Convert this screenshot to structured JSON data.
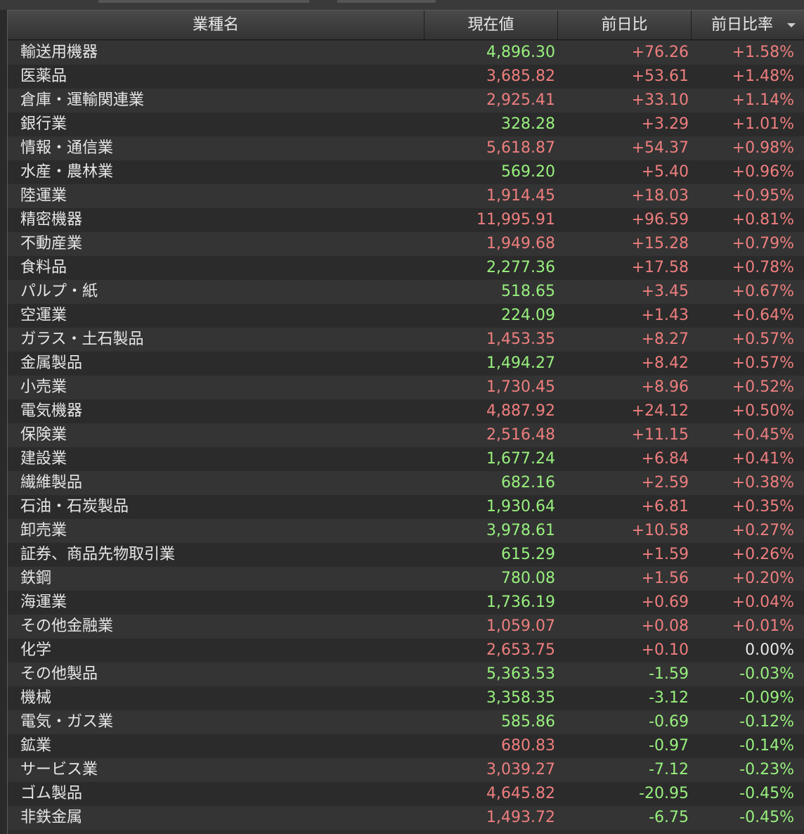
{
  "header": {
    "name": "業種名",
    "price": "現在値",
    "change": "前日比",
    "rate": "前日比率"
  },
  "colors": {
    "up": "#ee7e7e",
    "green": "#98f07e",
    "neutral": "#e8e8e8"
  },
  "rows": [
    {
      "name": "輸送用機器",
      "price": "4,896.30",
      "change": "+76.26",
      "rate": "+1.58%",
      "pc": "green",
      "cc": "up",
      "rc": "up"
    },
    {
      "name": "医薬品",
      "price": "3,685.82",
      "change": "+53.61",
      "rate": "+1.48%",
      "pc": "up",
      "cc": "up",
      "rc": "up"
    },
    {
      "name": "倉庫・運輸関連業",
      "price": "2,925.41",
      "change": "+33.10",
      "rate": "+1.14%",
      "pc": "up",
      "cc": "up",
      "rc": "up"
    },
    {
      "name": "銀行業",
      "price": "328.28",
      "change": "+3.29",
      "rate": "+1.01%",
      "pc": "green",
      "cc": "up",
      "rc": "up"
    },
    {
      "name": "情報・通信業",
      "price": "5,618.87",
      "change": "+54.37",
      "rate": "+0.98%",
      "pc": "up",
      "cc": "up",
      "rc": "up"
    },
    {
      "name": "水産・農林業",
      "price": "569.20",
      "change": "+5.40",
      "rate": "+0.96%",
      "pc": "green",
      "cc": "up",
      "rc": "up"
    },
    {
      "name": "陸運業",
      "price": "1,914.45",
      "change": "+18.03",
      "rate": "+0.95%",
      "pc": "up",
      "cc": "up",
      "rc": "up"
    },
    {
      "name": "精密機器",
      "price": "11,995.91",
      "change": "+96.59",
      "rate": "+0.81%",
      "pc": "up",
      "cc": "up",
      "rc": "up"
    },
    {
      "name": "不動産業",
      "price": "1,949.68",
      "change": "+15.28",
      "rate": "+0.79%",
      "pc": "up",
      "cc": "up",
      "rc": "up"
    },
    {
      "name": "食料品",
      "price": "2,277.36",
      "change": "+17.58",
      "rate": "+0.78%",
      "pc": "green",
      "cc": "up",
      "rc": "up"
    },
    {
      "name": "パルプ・紙",
      "price": "518.65",
      "change": "+3.45",
      "rate": "+0.67%",
      "pc": "green",
      "cc": "up",
      "rc": "up"
    },
    {
      "name": "空運業",
      "price": "224.09",
      "change": "+1.43",
      "rate": "+0.64%",
      "pc": "green",
      "cc": "up",
      "rc": "up"
    },
    {
      "name": "ガラス・土石製品",
      "price": "1,453.35",
      "change": "+8.27",
      "rate": "+0.57%",
      "pc": "up",
      "cc": "up",
      "rc": "up"
    },
    {
      "name": "金属製品",
      "price": "1,494.27",
      "change": "+8.42",
      "rate": "+0.57%",
      "pc": "green",
      "cc": "up",
      "rc": "up"
    },
    {
      "name": "小売業",
      "price": "1,730.45",
      "change": "+8.96",
      "rate": "+0.52%",
      "pc": "up",
      "cc": "up",
      "rc": "up"
    },
    {
      "name": "電気機器",
      "price": "4,887.92",
      "change": "+24.12",
      "rate": "+0.50%",
      "pc": "up",
      "cc": "up",
      "rc": "up"
    },
    {
      "name": "保険業",
      "price": "2,516.48",
      "change": "+11.15",
      "rate": "+0.45%",
      "pc": "up",
      "cc": "up",
      "rc": "up"
    },
    {
      "name": "建設業",
      "price": "1,677.24",
      "change": "+6.84",
      "rate": "+0.41%",
      "pc": "green",
      "cc": "up",
      "rc": "up"
    },
    {
      "name": "繊維製品",
      "price": "682.16",
      "change": "+2.59",
      "rate": "+0.38%",
      "pc": "green",
      "cc": "up",
      "rc": "up"
    },
    {
      "name": "石油・石炭製品",
      "price": "1,930.64",
      "change": "+6.81",
      "rate": "+0.35%",
      "pc": "green",
      "cc": "up",
      "rc": "up"
    },
    {
      "name": "卸売業",
      "price": "3,978.61",
      "change": "+10.58",
      "rate": "+0.27%",
      "pc": "green",
      "cc": "up",
      "rc": "up"
    },
    {
      "name": "証券、商品先物取引業",
      "price": "615.29",
      "change": "+1.59",
      "rate": "+0.26%",
      "pc": "green",
      "cc": "up",
      "rc": "up"
    },
    {
      "name": "鉄鋼",
      "price": "780.08",
      "change": "+1.56",
      "rate": "+0.20%",
      "pc": "green",
      "cc": "up",
      "rc": "up"
    },
    {
      "name": "海運業",
      "price": "1,736.19",
      "change": "+0.69",
      "rate": "+0.04%",
      "pc": "green",
      "cc": "up",
      "rc": "up"
    },
    {
      "name": "その他金融業",
      "price": "1,059.07",
      "change": "+0.08",
      "rate": "+0.01%",
      "pc": "up",
      "cc": "up",
      "rc": "up"
    },
    {
      "name": "化学",
      "price": "2,653.75",
      "change": "+0.10",
      "rate": "0.00%",
      "pc": "up",
      "cc": "up",
      "rc": "neutral"
    },
    {
      "name": "その他製品",
      "price": "5,363.53",
      "change": "-1.59",
      "rate": "-0.03%",
      "pc": "green",
      "cc": "green",
      "rc": "green"
    },
    {
      "name": "機械",
      "price": "3,358.35",
      "change": "-3.12",
      "rate": "-0.09%",
      "pc": "green",
      "cc": "green",
      "rc": "green"
    },
    {
      "name": "電気・ガス業",
      "price": "585.86",
      "change": "-0.69",
      "rate": "-0.12%",
      "pc": "green",
      "cc": "green",
      "rc": "green"
    },
    {
      "name": "鉱業",
      "price": "680.83",
      "change": "-0.97",
      "rate": "-0.14%",
      "pc": "up",
      "cc": "green",
      "rc": "green"
    },
    {
      "name": "サービス業",
      "price": "3,039.27",
      "change": "-7.12",
      "rate": "-0.23%",
      "pc": "up",
      "cc": "green",
      "rc": "green"
    },
    {
      "name": "ゴム製品",
      "price": "4,645.82",
      "change": "-20.95",
      "rate": "-0.45%",
      "pc": "up",
      "cc": "green",
      "rc": "green"
    },
    {
      "name": "非鉄金属",
      "price": "1,493.72",
      "change": "-6.75",
      "rate": "-0.45%",
      "pc": "up",
      "cc": "green",
      "rc": "green"
    }
  ]
}
